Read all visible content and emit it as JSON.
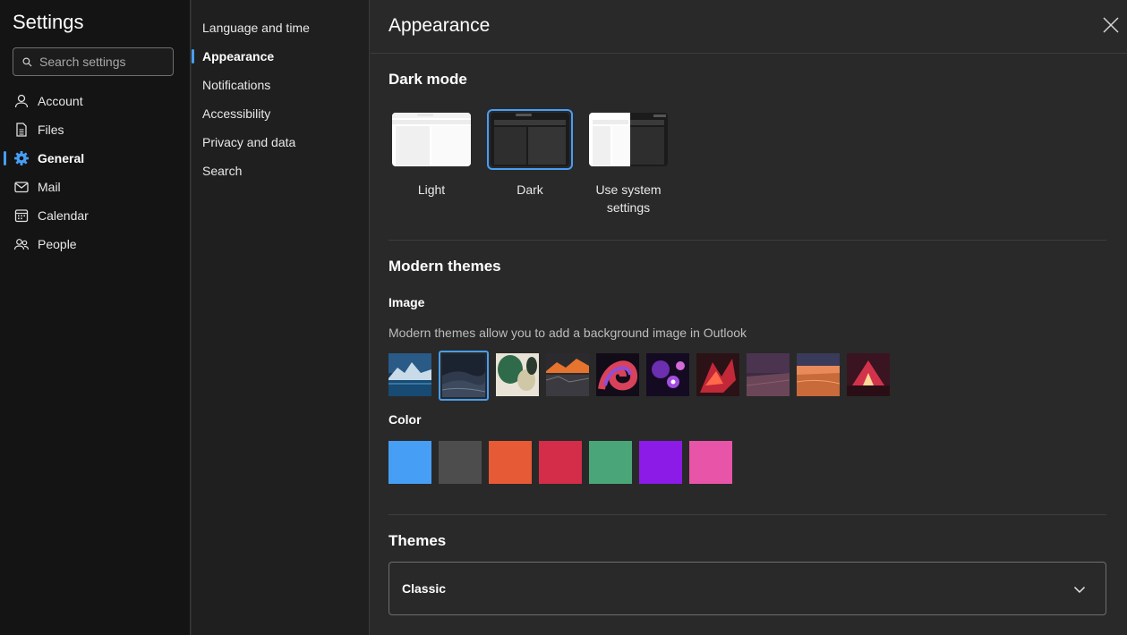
{
  "left_nav": {
    "title": "Settings",
    "search_placeholder": "Search settings",
    "items": [
      {
        "label": "Account",
        "icon": "person-icon"
      },
      {
        "label": "Files",
        "icon": "document-icon"
      },
      {
        "label": "General",
        "icon": "gear-icon",
        "active": true
      },
      {
        "label": "Mail",
        "icon": "mail-icon"
      },
      {
        "label": "Calendar",
        "icon": "calendar-icon"
      },
      {
        "label": "People",
        "icon": "people-icon"
      }
    ]
  },
  "sub_nav": {
    "items": [
      {
        "label": "Language and time"
      },
      {
        "label": "Appearance",
        "active": true
      },
      {
        "label": "Notifications"
      },
      {
        "label": "Accessibility"
      },
      {
        "label": "Privacy and data"
      },
      {
        "label": "Search"
      }
    ]
  },
  "main": {
    "title": "Appearance",
    "dark_mode": {
      "heading": "Dark mode",
      "options": [
        {
          "label": "Light"
        },
        {
          "label": "Dark",
          "selected": true
        },
        {
          "label": "Use system settings"
        }
      ]
    },
    "modern_themes": {
      "heading": "Modern themes",
      "image_heading": "Image",
      "description": "Modern themes allow you to add a background image in Outlook",
      "color_heading": "Color",
      "colors": [
        "#479ef5",
        "#4d4d4d",
        "#e65a35",
        "#d42d4a",
        "#4aa678",
        "#8d1be8",
        "#e855a8"
      ]
    },
    "themes": {
      "heading": "Themes",
      "selected": "Classic"
    }
  },
  "colors": {
    "accent": "#479ef5",
    "nav_bg": "#141414",
    "mid_bg": "#1f1f1f",
    "main_bg": "#292929"
  }
}
